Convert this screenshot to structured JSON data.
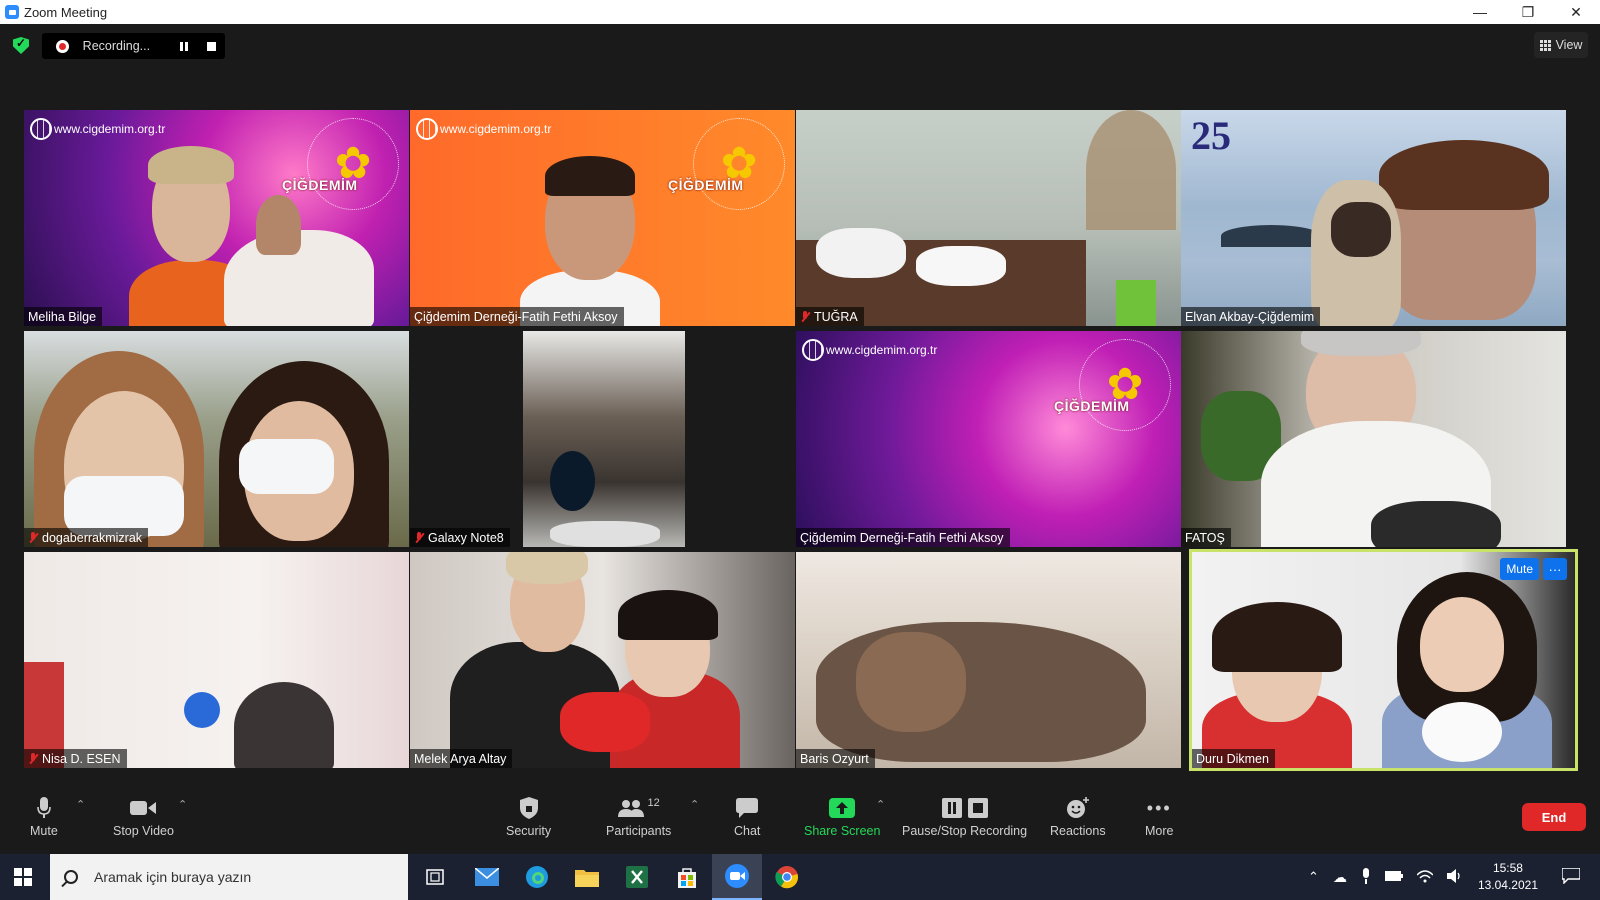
{
  "window": {
    "title": "Zoom Meeting"
  },
  "recording": {
    "label": "Recording...",
    "status_color": "#e02828"
  },
  "view_button": {
    "label": "View"
  },
  "participants": [
    {
      "name": "Meliha Bilge",
      "muted": false
    },
    {
      "name": "Çiğdemim Derneği-Fatih Fethi Aksoy",
      "muted": false
    },
    {
      "name": "TUĞRA",
      "muted": true
    },
    {
      "name": "Elvan Akbay-Çiğdemim",
      "muted": false
    },
    {
      "name": "dogaberrakmizrak",
      "muted": true
    },
    {
      "name": "Galaxy Note8",
      "muted": true
    },
    {
      "name": "Çiğdemim Derneği-Fatih Fethi Aksoy",
      "muted": false
    },
    {
      "name": "FATOŞ",
      "muted": false
    },
    {
      "name": "Nisa D. ESEN",
      "muted": true
    },
    {
      "name": "Melek Arya Altay",
      "muted": false
    },
    {
      "name": "Baris Ozyurt",
      "muted": false
    },
    {
      "name": "Duru Dikmen",
      "muted": false,
      "active_speaker": true
    }
  ],
  "branding": {
    "url": "www.cigdemim.org.tr",
    "org": "ÇİĞDEMİM",
    "anniversary": "25"
  },
  "hover_controls": {
    "mute": "Mute",
    "more": "···"
  },
  "toolbar": {
    "mute": "Mute",
    "stop_video": "Stop Video",
    "security": "Security",
    "participants": "Participants",
    "participants_count": "12",
    "chat": "Chat",
    "share_screen": "Share Screen",
    "pause_stop_recording": "Pause/Stop Recording",
    "reactions": "Reactions",
    "more": "More",
    "end": "End"
  },
  "taskbar": {
    "search_placeholder": "Aramak için buraya yazın",
    "time": "15:58",
    "date": "13.04.2021"
  },
  "colors": {
    "accent_blue": "#0e72ed",
    "end_red": "#e02828",
    "share_green": "#23d959",
    "active_border": "#c8e26a"
  }
}
